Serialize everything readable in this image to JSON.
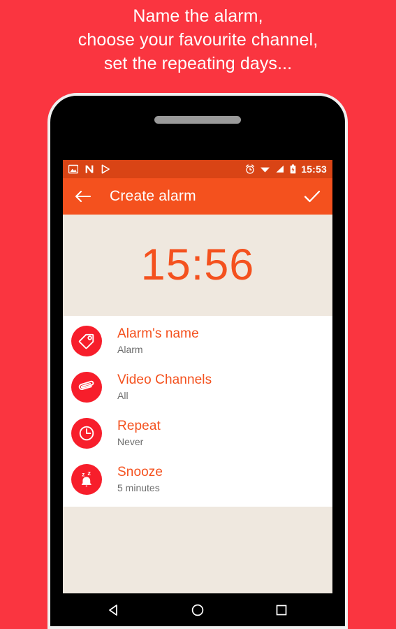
{
  "promo": {
    "lines": [
      "Name the alarm,",
      "choose your favourite channel,",
      "set the repeating days..."
    ]
  },
  "colors": {
    "background_red": "#FA3540",
    "appbar_orange": "#F4511E",
    "statusbar_orange": "#D94415",
    "cream": "#EFE8DF",
    "icon_red": "#F71E2B",
    "title_orange": "#F4511E",
    "subtitle_gray": "#6E6E6E"
  },
  "phone": {
    "statusbar": {
      "left_icons": [
        "image-icon",
        "nougat-n-icon",
        "play-store-icon"
      ],
      "right_icons": [
        "alarm-clock-icon",
        "wifi-icon",
        "signal-icon",
        "battery-charging-icon"
      ],
      "time": "15:53"
    },
    "appbar": {
      "back_icon": "arrow-left-icon",
      "title": "Create alarm",
      "confirm_icon": "check-icon"
    },
    "clock": {
      "time": "15:56"
    },
    "list": [
      {
        "icon": "tag-icon",
        "title": "Alarm's name",
        "subtitle": "Alarm"
      },
      {
        "icon": "paperclip-icon",
        "title": "Video Channels",
        "subtitle": "All"
      },
      {
        "icon": "clock-icon",
        "title": "Repeat",
        "subtitle": "Never"
      },
      {
        "icon": "snooze-bell-icon",
        "title": "Snooze",
        "subtitle": "5 minutes"
      }
    ],
    "navbar": {
      "back": "back-triangle-icon",
      "home": "home-circle-icon",
      "recents": "recents-square-icon"
    }
  }
}
